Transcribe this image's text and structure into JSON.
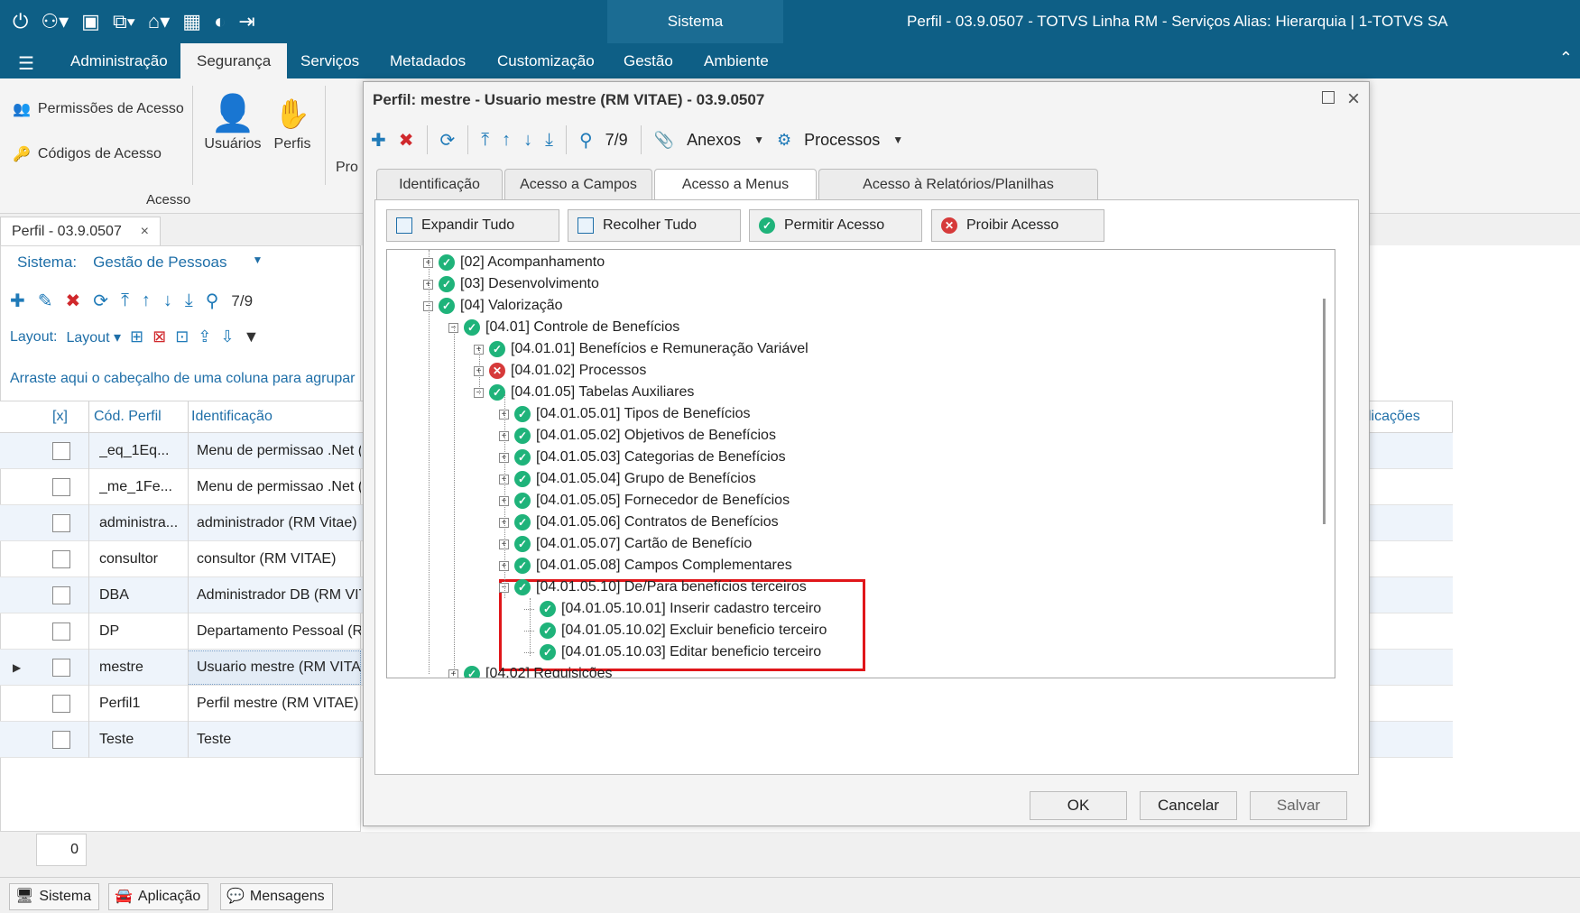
{
  "window": {
    "system_label": "Sistema",
    "title": "Perfil - 03.9.0507 - TOTVS Linha RM - Serviços  Alias: Hierarquia | 1-TOTVS SA"
  },
  "ribbon_tabs": [
    "Administração",
    "Segurança",
    "Serviços",
    "Metadados",
    "Customização",
    "Gestão",
    "Ambiente"
  ],
  "ribbon": {
    "permissoes": "Permissões de Acesso",
    "codigos": "Códigos de Acesso",
    "usuarios": "Usuários",
    "perfis": "Perfis",
    "pro": "Pro",
    "group_label": "Acesso"
  },
  "doc_tab": {
    "label": "Perfil - 03.9.0507",
    "close": "×"
  },
  "left": {
    "sistema_label": "Sistema:",
    "sistema_value": "Gestão de Pessoas",
    "pager": "7/9",
    "layout_label": "Layout:",
    "layout_dropdown": "Layout",
    "group_hint": "Arraste aqui o cabeçalho de uma coluna para agrupar",
    "columns": [
      "[x]",
      "Cód. Perfil",
      "Identificação",
      "licações"
    ],
    "rows": [
      {
        "code": "_eq_1Eq...",
        "ident": "Menu de permissao .Net (",
        "selected": false
      },
      {
        "code": "_me_1Fe...",
        "ident": "Menu de permissao .Net (",
        "selected": false
      },
      {
        "code": "administra...",
        "ident": "administrador (RM Vitae)",
        "selected": false
      },
      {
        "code": "consultor",
        "ident": "consultor (RM VITAE)",
        "selected": false
      },
      {
        "code": "DBA",
        "ident": "Administrador DB (RM VIT",
        "selected": false
      },
      {
        "code": "DP",
        "ident": "Departamento Pessoal (R",
        "selected": false
      },
      {
        "code": "mestre",
        "ident": "Usuario mestre (RM VITA",
        "selected": true
      },
      {
        "code": "Perfil1",
        "ident": "Perfil mestre (RM VITAE)",
        "selected": false
      },
      {
        "code": "Teste",
        "ident": "Teste",
        "selected": false
      }
    ],
    "count": "0"
  },
  "statusbar": {
    "sistema": "Sistema",
    "aplicacao": "Aplicação",
    "mensagens": "Mensagens"
  },
  "dialog": {
    "title": "Perfil: mestre - Usuario mestre (RM VITAE) - 03.9.0507",
    "pager": "7/9",
    "anexos": "Anexos",
    "processos": "Processos",
    "tabs": [
      "Identificação",
      "Acesso a Campos",
      "Acesso a Menus",
      "Acesso à Relatórios/Planilhas"
    ],
    "active_tab": "Acesso a Menus",
    "buttons": {
      "expandir": "Expandir Tudo",
      "recolher": "Recolher Tudo",
      "permitir": "Permitir Acesso",
      "proibir": "Proibir Acesso"
    },
    "tree": [
      {
        "label": "[02] Acompanhamento",
        "status": "allowed",
        "expander": "+"
      },
      {
        "label": "[03] Desenvolvimento",
        "status": "allowed",
        "expander": "+"
      },
      {
        "label": "[04] Valorização",
        "status": "allowed",
        "expander": "−"
      },
      {
        "label": "[04.01] Controle de Benefícios",
        "status": "allowed",
        "expander": "−"
      },
      {
        "label": "[04.01.01] Benefícios e Remuneração Variável",
        "status": "allowed",
        "expander": "+"
      },
      {
        "label": "[04.01.02] Processos",
        "status": "denied",
        "expander": "+"
      },
      {
        "label": "[04.01.05] Tabelas Auxiliares",
        "status": "allowed",
        "expander": "−"
      },
      {
        "label": "[04.01.05.01] Tipos de Benefícios",
        "status": "allowed",
        "expander": "+"
      },
      {
        "label": "[04.01.05.02] Objetivos de Benefícios",
        "status": "allowed",
        "expander": "+"
      },
      {
        "label": "[04.01.05.03] Categorias de Benefícios",
        "status": "allowed",
        "expander": "+"
      },
      {
        "label": "[04.01.05.04] Grupo de Benefícios",
        "status": "allowed",
        "expander": "+"
      },
      {
        "label": "[04.01.05.05] Fornecedor de Benefícios",
        "status": "allowed",
        "expander": "+"
      },
      {
        "label": "[04.01.05.06] Contratos de Benefícios",
        "status": "allowed",
        "expander": "+"
      },
      {
        "label": "[04.01.05.07] Cartão de Benefício",
        "status": "allowed",
        "expander": "+"
      },
      {
        "label": "[04.01.05.08] Campos Complementares",
        "status": "allowed",
        "expander": "+"
      },
      {
        "label": "[04.01.05.10] De/Para benefícios terceiros",
        "status": "allowed",
        "expander": "−"
      },
      {
        "label": "[04.01.05.10.01] Inserir cadastro terceiro",
        "status": "allowed",
        "expander": ""
      },
      {
        "label": "[04.01.05.10.02] Excluir beneficio terceiro",
        "status": "allowed",
        "expander": ""
      },
      {
        "label": "[04.01.05.10.03] Editar beneficio terceiro",
        "status": "allowed",
        "expander": ""
      },
      {
        "label": "[04.02] Requisições",
        "status": "allowed",
        "expander": "+"
      }
    ],
    "ok": "OK",
    "cancelar": "Cancelar",
    "salvar": "Salvar"
  }
}
